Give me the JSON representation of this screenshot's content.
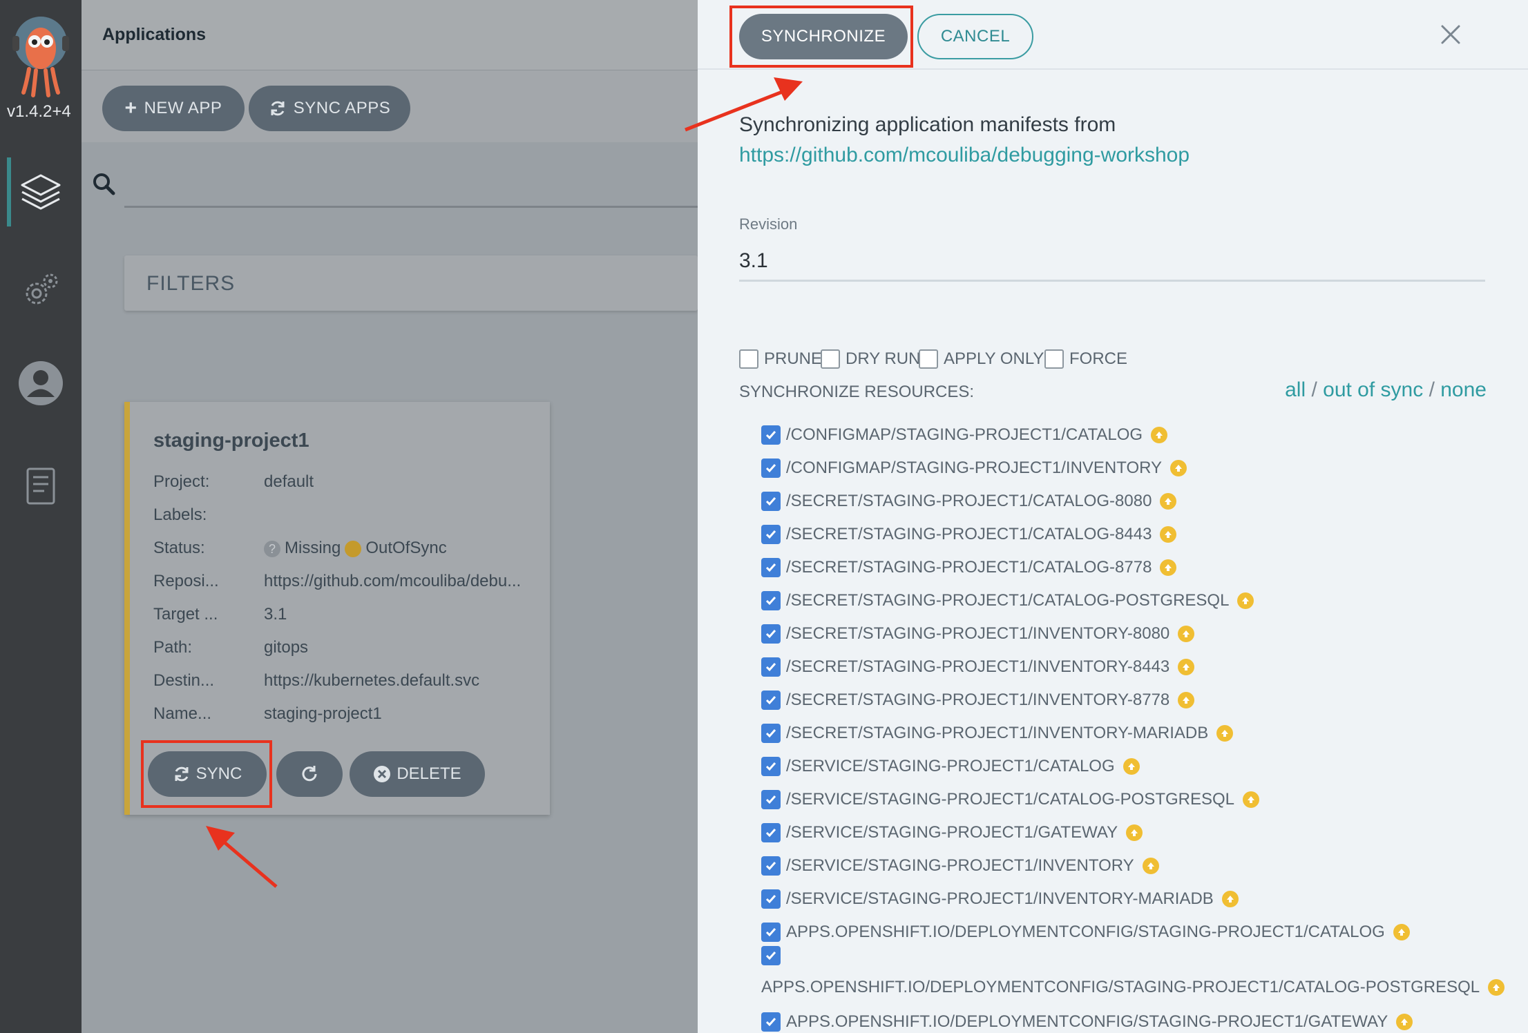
{
  "sidebar": {
    "version": "v1.4.2+4",
    "items": [
      {
        "name": "applications",
        "icon": "layers-icon"
      },
      {
        "name": "settings",
        "icon": "gears-icon"
      },
      {
        "name": "user",
        "icon": "user-icon"
      },
      {
        "name": "docs",
        "icon": "book-icon"
      }
    ]
  },
  "header": {
    "title": "Applications"
  },
  "toolbar": {
    "new_app": "NEW APP",
    "sync_apps": "SYNC APPS"
  },
  "filters": {
    "label": "FILTERS"
  },
  "app_card": {
    "name": "staging-project1",
    "rows": [
      {
        "label": "Project:",
        "value": "default"
      },
      {
        "label": "Labels:",
        "value": ""
      },
      {
        "label": "Status:",
        "health": "Missing",
        "sync": "OutOfSync"
      },
      {
        "label": "Reposi...",
        "value": "https://github.com/mcouliba/debu..."
      },
      {
        "label": "Target ...",
        "value": "3.1"
      },
      {
        "label": "Path:",
        "value": "gitops"
      },
      {
        "label": "Destin...",
        "value": "https://kubernetes.default.svc"
      },
      {
        "label": "Name...",
        "value": "staging-project1"
      }
    ],
    "buttons": {
      "sync": "SYNC",
      "delete": "DELETE"
    }
  },
  "panel": {
    "synchronize": "SYNCHRONIZE",
    "cancel": "CANCEL",
    "intro": "Synchronizing application manifests from",
    "repo_url": "https://github.com/mcouliba/debugging-workshop",
    "revision_label": "Revision",
    "revision_value": "3.1",
    "options": [
      "PRUNE",
      "DRY RUN",
      "APPLY ONLY",
      "FORCE"
    ],
    "resources_label": "SYNCHRONIZE RESOURCES:",
    "select_all": "all",
    "select_out_of_sync": "out of sync",
    "select_none": "none",
    "separator": "/",
    "resources": [
      "/CONFIGMAP/STAGING-PROJECT1/CATALOG",
      "/CONFIGMAP/STAGING-PROJECT1/INVENTORY",
      "/SECRET/STAGING-PROJECT1/CATALOG-8080",
      "/SECRET/STAGING-PROJECT1/CATALOG-8443",
      "/SECRET/STAGING-PROJECT1/CATALOG-8778",
      "/SECRET/STAGING-PROJECT1/CATALOG-POSTGRESQL",
      "/SECRET/STAGING-PROJECT1/INVENTORY-8080",
      "/SECRET/STAGING-PROJECT1/INVENTORY-8443",
      "/SECRET/STAGING-PROJECT1/INVENTORY-8778",
      "/SECRET/STAGING-PROJECT1/INVENTORY-MARIADB",
      "/SERVICE/STAGING-PROJECT1/CATALOG",
      "/SERVICE/STAGING-PROJECT1/CATALOG-POSTGRESQL",
      "/SERVICE/STAGING-PROJECT1/GATEWAY",
      "/SERVICE/STAGING-PROJECT1/INVENTORY",
      "/SERVICE/STAGING-PROJECT1/INVENTORY-MARIADB",
      "APPS.OPENSHIFT.IO/DEPLOYMENTCONFIG/STAGING-PROJECT1/CATALOG",
      "APPS.OPENSHIFT.IO/DEPLOYMENTCONFIG/STAGING-PROJECT1/CATALOG-POSTGRESQL",
      "APPS.OPENSHIFT.IO/DEPLOYMENTCONFIG/STAGING-PROJECT1/GATEWAY"
    ]
  },
  "colors": {
    "accent": "#2f9ba1",
    "checkbox": "#3f7fd8",
    "out_of_sync": "#f0be33",
    "annotation": "#e8321e"
  }
}
